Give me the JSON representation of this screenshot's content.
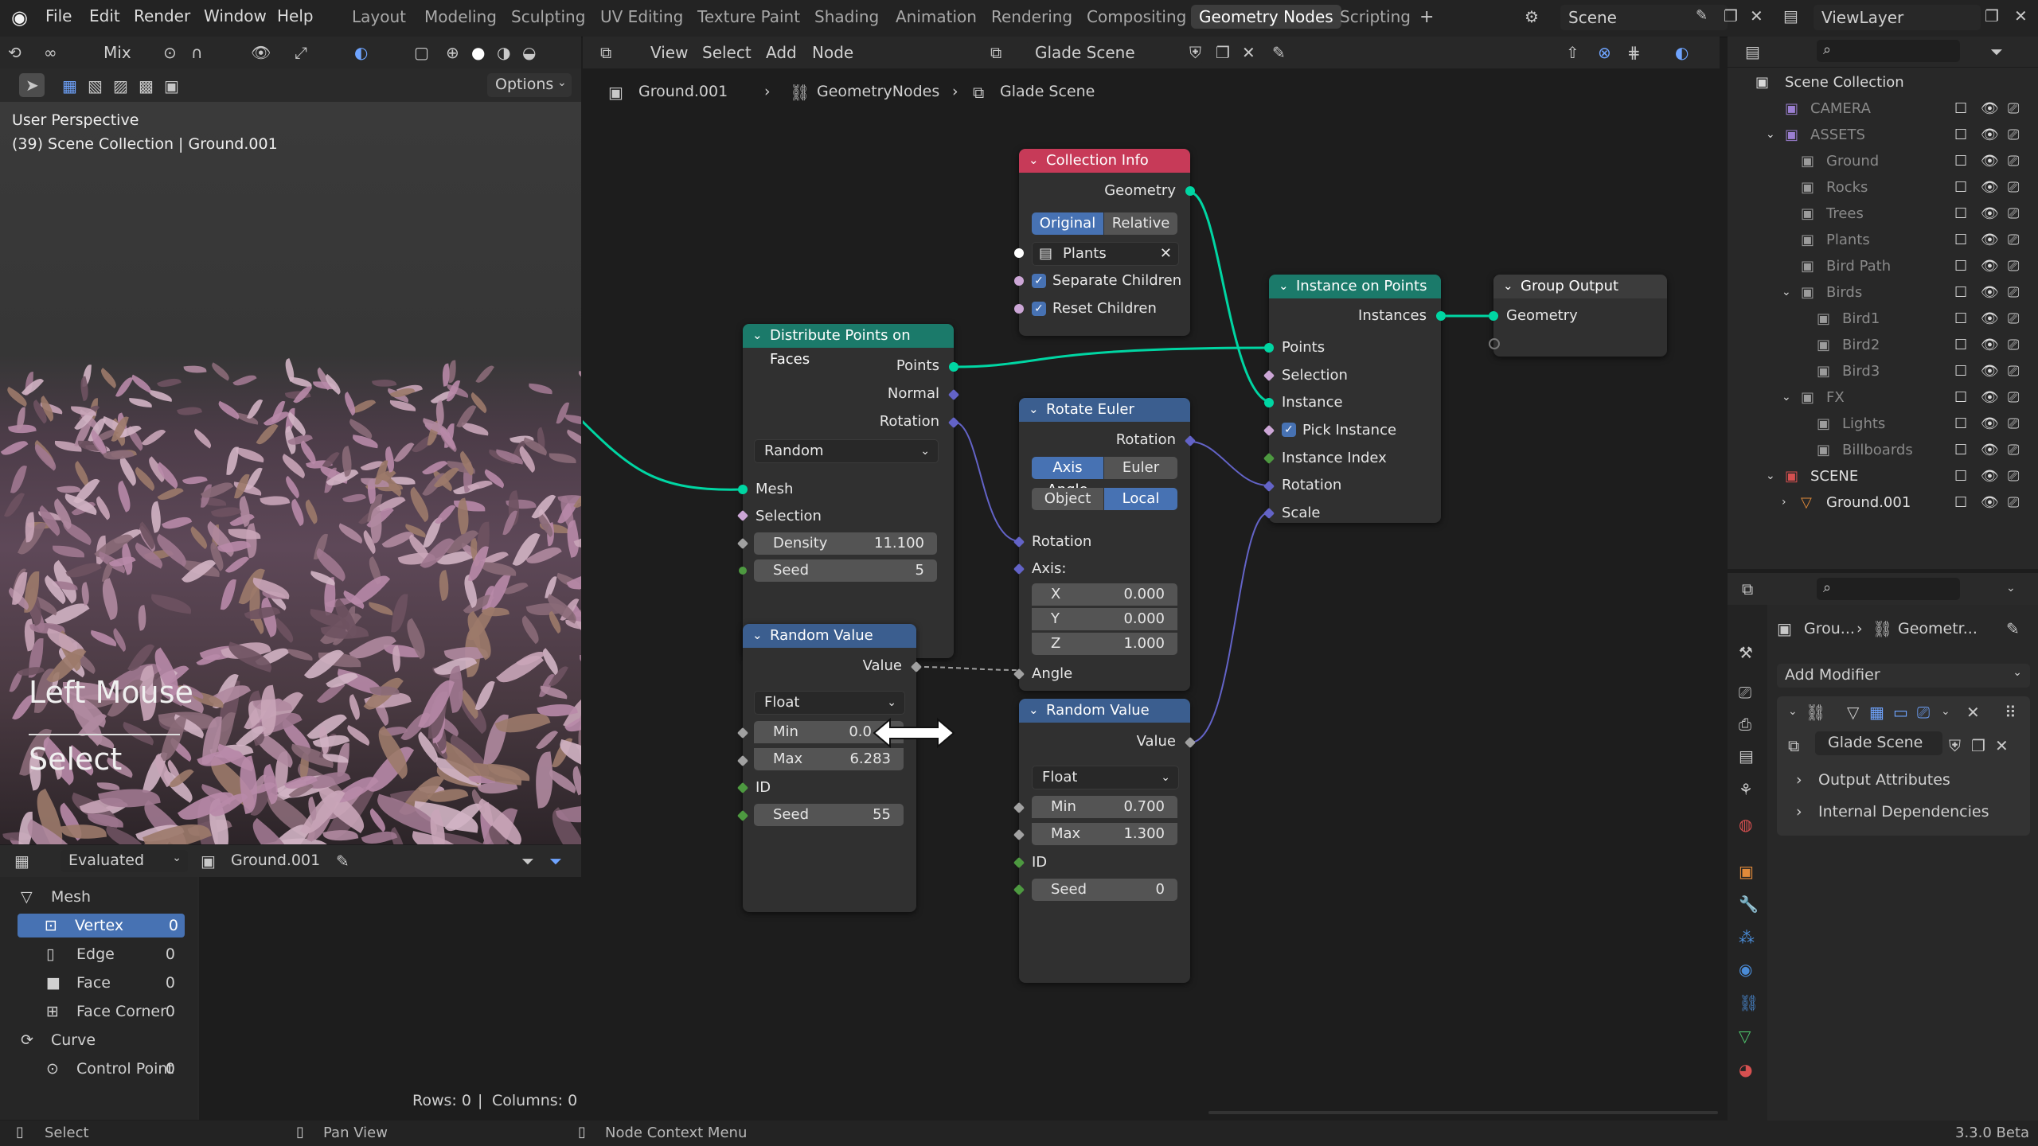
{
  "menus": [
    "File",
    "Edit",
    "Render",
    "Window",
    "Help"
  ],
  "workspaces": [
    "Layout",
    "Modeling",
    "Sculpting",
    "UV Editing",
    "Texture Paint",
    "Shading",
    "Animation",
    "Rendering",
    "Compositing",
    "Geometry Nodes",
    "Scripting"
  ],
  "active_workspace": "Geometry Nodes",
  "scene_name": "Scene",
  "view_layer": "ViewLayer",
  "viewport": {
    "mode": "Mix",
    "options_label": "Options",
    "perspective": "User Perspective",
    "collection_info": "(39) Scene Collection | Ground.001",
    "overlay_action": "Left Mouse",
    "overlay_result": "Select"
  },
  "node_header": {
    "menus": [
      "View",
      "Select",
      "Add",
      "Node"
    ],
    "tree_name": "Glade Scene"
  },
  "breadcrumb": [
    "Ground.001",
    "GeometryNodes",
    "Glade Scene"
  ],
  "nodes": {
    "collection_info": {
      "title": "Collection Info",
      "out_geometry": "Geometry",
      "mode_a": "Original",
      "mode_b": "Relative",
      "collection": "Plants",
      "separate": "Separate Children",
      "reset": "Reset Children"
    },
    "distribute": {
      "title": "Distribute Points on Faces",
      "points": "Points",
      "normal": "Normal",
      "rotation": "Rotation",
      "method": "Random",
      "mesh": "Mesh",
      "selection": "Selection",
      "density_label": "Density",
      "density": "11.100",
      "seed_label": "Seed",
      "seed": "5"
    },
    "rotate": {
      "title": "Rotate Euler",
      "out_rotation": "Rotation",
      "type_a": "Axis Angle",
      "type_b": "Euler",
      "space_a": "Object",
      "space_b": "Local",
      "rotation": "Rotation",
      "axis": "Axis:",
      "x_label": "X",
      "x": "0.000",
      "y_label": "Y",
      "y": "0.000",
      "z_label": "Z",
      "z": "1.000",
      "angle": "Angle"
    },
    "instance": {
      "title": "Instance on Points",
      "out": "Instances",
      "points": "Points",
      "selection": "Selection",
      "instance": "Instance",
      "pick": "Pick Instance",
      "index": "Instance Index",
      "rotation": "Rotation",
      "scale": "Scale"
    },
    "output": {
      "title": "Group Output",
      "geometry": "Geometry"
    },
    "random1": {
      "title": "Random Value",
      "value": "Value",
      "type": "Float",
      "min_label": "Min",
      "min": "0.0",
      "max_label": "Max",
      "max": "6.283",
      "id": "ID",
      "seed_label": "Seed",
      "seed": "55"
    },
    "random2": {
      "title": "Random Value",
      "value": "Value",
      "type": "Float",
      "min_label": "Min",
      "min": "0.700",
      "max_label": "Max",
      "max": "1.300",
      "id": "ID",
      "seed_label": "Seed",
      "seed": "0"
    }
  },
  "outliner": {
    "root": "Scene Collection",
    "items": [
      {
        "label": "CAMERA"
      },
      {
        "label": "ASSETS"
      },
      {
        "label": "Ground"
      },
      {
        "label": "Rocks"
      },
      {
        "label": "Trees"
      },
      {
        "label": "Plants"
      },
      {
        "label": "Bird Path"
      },
      {
        "label": "Birds"
      },
      {
        "label": "Bird1"
      },
      {
        "label": "Bird2"
      },
      {
        "label": "Bird3"
      },
      {
        "label": "FX"
      },
      {
        "label": "Lights"
      },
      {
        "label": "Billboards"
      },
      {
        "label": "SCENE"
      },
      {
        "label": "Ground.001"
      }
    ]
  },
  "properties": {
    "crumb_a": "Grou...",
    "crumb_b": "Geometr...",
    "add_modifier": "Add Modifier",
    "tree": "Glade Scene",
    "output_attrs": "Output Attributes",
    "internal": "Internal Dependencies"
  },
  "spreadsheet": {
    "mode": "Evaluated",
    "object": "Ground.001",
    "domains": [
      {
        "label": "Mesh",
        "count": ""
      },
      {
        "label": "Vertex",
        "count": "0"
      },
      {
        "label": "Edge",
        "count": "0"
      },
      {
        "label": "Face",
        "count": "0"
      },
      {
        "label": "Face Corner",
        "count": "0"
      },
      {
        "label": "Curve",
        "count": ""
      },
      {
        "label": "Control Point",
        "count": "0"
      }
    ],
    "rows": "Rows: 0",
    "sep": "|",
    "columns": "Columns: 0"
  },
  "status": {
    "select": "Select",
    "pan": "Pan View",
    "context": "Node Context Menu",
    "version": "3.3.0 Beta"
  }
}
